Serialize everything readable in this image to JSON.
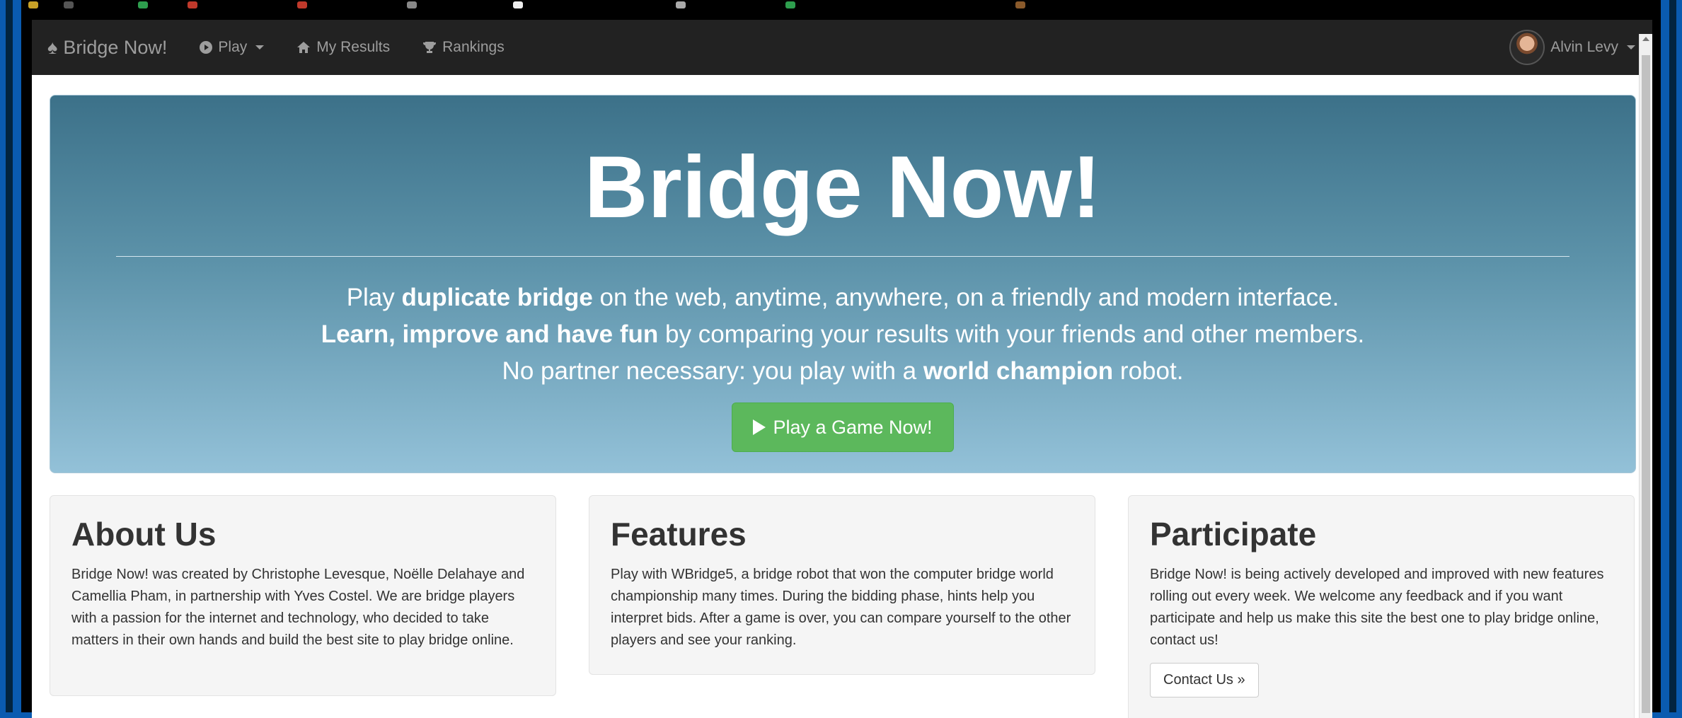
{
  "navbar": {
    "brand": "Bridge Now!",
    "play": "Play",
    "my_results": "My Results",
    "rankings": "Rankings",
    "user_name": "Alvin Levy"
  },
  "hero": {
    "title": "Bridge Now!",
    "line1": [
      {
        "text": "Play ",
        "bold": false
      },
      {
        "text": "duplicate bridge",
        "bold": true
      },
      {
        "text": " on the web, anytime, anywhere, on a friendly and modern interface.",
        "bold": false
      }
    ],
    "line2": [
      {
        "text": "Learn, improve and have fun",
        "bold": true
      },
      {
        "text": " by comparing your results with your friends and other members.",
        "bold": false
      }
    ],
    "line3": [
      {
        "text": "No partner necessary: you play with a ",
        "bold": false
      },
      {
        "text": "world champion",
        "bold": true
      },
      {
        "text": " robot.",
        "bold": false
      }
    ],
    "cta": "Play a Game Now!"
  },
  "panels": {
    "about": {
      "title": "About Us",
      "body": "Bridge Now! was created by Christophe Levesque, Noëlle Delahaye and Camellia Pham, in partnership with Yves Costel. We are bridge players with a passion for the internet and technology, who decided to take matters in their own hands and build the best site to play bridge online."
    },
    "features": {
      "title": "Features",
      "body": "Play with WBridge5, a bridge robot that won the computer bridge world championship many times. During the bidding phase, hints help you interpret bids. After a game is over, you can compare yourself to the other players and see your ranking."
    },
    "participate": {
      "title": "Participate",
      "body": "Bridge Now! is being actively developed and improved with new features rolling out every week. We welcome any feedback and if you want participate and help us make this site the best one to play bridge online, contact us!",
      "button": "Contact Us »"
    }
  },
  "colors": {
    "navbar_bg": "#222222",
    "hero_top": "#3c7189",
    "hero_bottom": "#93c1d8",
    "cta_green": "#5cb85c",
    "frame_blue": "#0a5bb0"
  },
  "icons": {
    "brand": "spade-icon",
    "play": "play-circle-icon",
    "my_results": "home-icon",
    "rankings": "trophy-icon",
    "cta": "play-triangle-icon"
  }
}
